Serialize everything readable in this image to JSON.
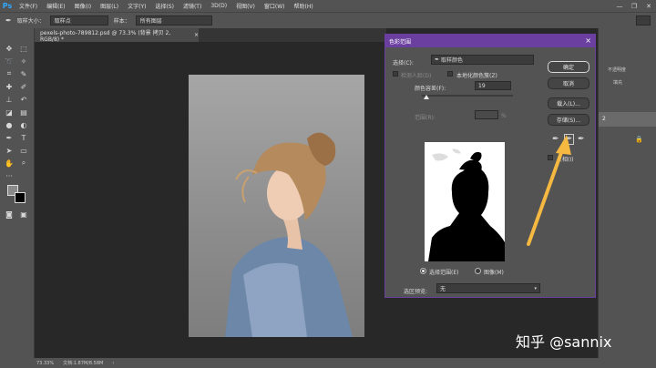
{
  "app": {
    "logo": "Ps"
  },
  "menu": [
    "文件(F)",
    "编辑(E)",
    "图像(I)",
    "图层(L)",
    "文字(Y)",
    "选择(S)",
    "滤镜(T)",
    "3D(D)",
    "视图(V)",
    "窗口(W)",
    "帮助(H)"
  ],
  "window_controls": {
    "minimize": "—",
    "restore": "❐",
    "close": "✕"
  },
  "options_bar": {
    "sample_size_label": "取样大小：",
    "sample_size_value": "取样点",
    "sample_label": "样本：",
    "sample_value": "所有图层"
  },
  "document_tab": {
    "title": "pexels-photo-789812.psd @ 73.3% (背景 拷贝 2, RGB/8) *",
    "close": "×"
  },
  "status_bar": {
    "zoom": "73.33%",
    "doc_info": "文档:1.87M/8.58M",
    "arrow": "›"
  },
  "right_panel": {
    "item1": "不透明度",
    "item2": "填充",
    "layer_num": "2"
  },
  "dialog": {
    "title": "色彩范围",
    "close": "×",
    "select_label": "选择(C):",
    "select_value": "取样颜色",
    "detect_faces": "检测人脸(D)",
    "localized_clusters": "本地化颜色簇(Z)",
    "fuzziness_label": "颜色容差(F):",
    "fuzziness_value": "19",
    "range_label": "范围(R):",
    "range_unit": "%",
    "buttons": {
      "ok": "确定",
      "cancel": "取消",
      "load": "载入(L)...",
      "save": "存储(S)..."
    },
    "invert_label": "反相(I)",
    "radio_selection": "选择范围(E)",
    "radio_image": "图像(M)",
    "preview_label": "选区预览:",
    "preview_value": "无",
    "fuzziness_slider": 0.05
  },
  "watermark": "知乎 @sannix",
  "colors": {
    "dialog_accent": "#6b3fa0",
    "arrow": "#f5b840"
  }
}
